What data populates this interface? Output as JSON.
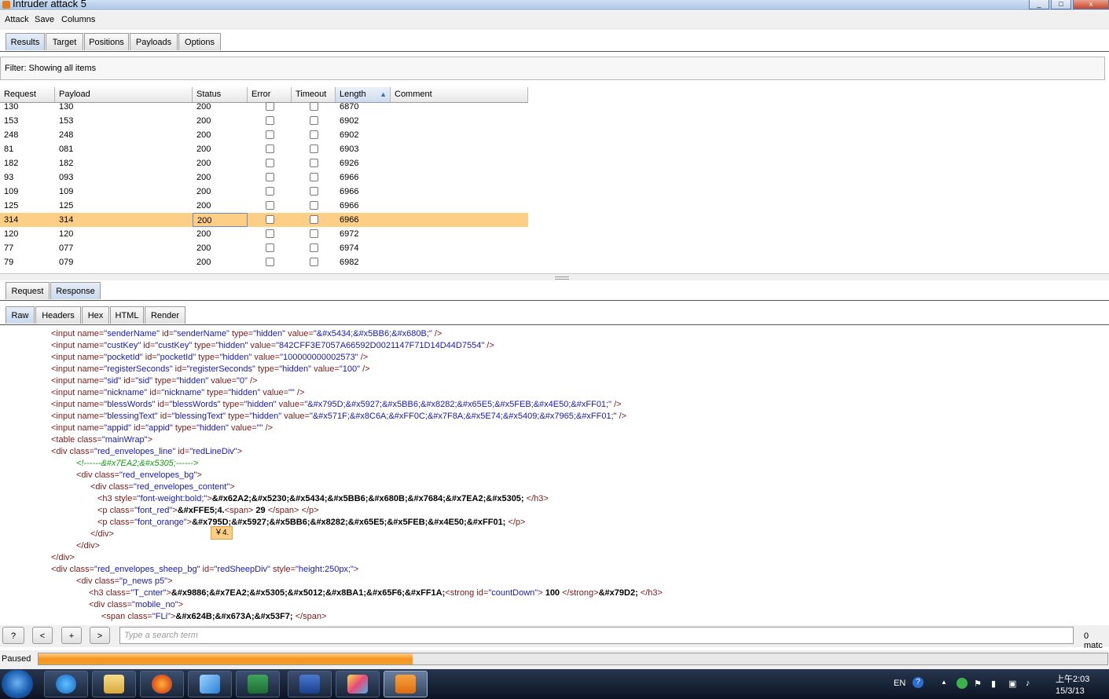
{
  "window": {
    "title": "Intruder attack 5",
    "controls": [
      "_",
      "□",
      "x"
    ]
  },
  "menu": [
    "Attack",
    "Save",
    "Columns"
  ],
  "tabs": [
    "Results",
    "Target",
    "Positions",
    "Payloads",
    "Options"
  ],
  "filter": {
    "text": "Filter:  Showing all items"
  },
  "table": {
    "columns": [
      "Request",
      "Payload",
      "Status",
      "Error",
      "Timeout",
      "Length",
      "Comment"
    ],
    "sorted_column": "Length",
    "rows": [
      {
        "request": "130",
        "payload": "130",
        "status": "200",
        "length": "6870"
      },
      {
        "request": "153",
        "payload": "153",
        "status": "200",
        "length": "6902"
      },
      {
        "request": "248",
        "payload": "248",
        "status": "200",
        "length": "6902"
      },
      {
        "request": "81",
        "payload": "081",
        "status": "200",
        "length": "6903"
      },
      {
        "request": "182",
        "payload": "182",
        "status": "200",
        "length": "6926"
      },
      {
        "request": "93",
        "payload": "093",
        "status": "200",
        "length": "6966"
      },
      {
        "request": "109",
        "payload": "109",
        "status": "200",
        "length": "6966"
      },
      {
        "request": "125",
        "payload": "125",
        "status": "200",
        "length": "6966"
      },
      {
        "request": "314",
        "payload": "314",
        "status": "200",
        "length": "6966",
        "selected": true
      },
      {
        "request": "120",
        "payload": "120",
        "status": "200",
        "length": "6972"
      },
      {
        "request": "77",
        "payload": "077",
        "status": "200",
        "length": "6974"
      },
      {
        "request": "79",
        "payload": "079",
        "status": "200",
        "length": "6982"
      }
    ]
  },
  "detail_tabs": [
    "Request",
    "Response"
  ],
  "view_tabs": [
    "Raw",
    "Headers",
    "Hex",
    "HTML",
    "Render"
  ],
  "code_lines": [
    {
      "indent": 65,
      "parts": [
        [
          "tag",
          "<input "
        ],
        [
          "attr",
          "name="
        ],
        [
          "val",
          "\"senderName\""
        ],
        [
          "attr",
          " id="
        ],
        [
          "val",
          "\"senderName\""
        ],
        [
          "attr",
          " type="
        ],
        [
          "val",
          "\"hidden\""
        ],
        [
          "attr",
          " value="
        ],
        [
          "val",
          "\"&#x5434;&#x5BB6;&#x680B;\""
        ],
        [
          "tag",
          " />"
        ]
      ]
    },
    {
      "indent": 65,
      "parts": [
        [
          "tag",
          "<input "
        ],
        [
          "attr",
          "name="
        ],
        [
          "val",
          "\"custKey\""
        ],
        [
          "attr",
          " id="
        ],
        [
          "val",
          "\"custKey\""
        ],
        [
          "attr",
          " type="
        ],
        [
          "val",
          "\"hidden\""
        ],
        [
          "attr",
          " value="
        ],
        [
          "val",
          "\"842CFF3E7057A66592D0021147F71D14D44D7554\""
        ],
        [
          "tag",
          " />"
        ]
      ]
    },
    {
      "indent": 65,
      "parts": [
        [
          "tag",
          "<input "
        ],
        [
          "attr",
          "name="
        ],
        [
          "val",
          "\"pocketId\""
        ],
        [
          "attr",
          " id="
        ],
        [
          "val",
          "\"pocketId\""
        ],
        [
          "attr",
          " type="
        ],
        [
          "val",
          "\"hidden\""
        ],
        [
          "attr",
          " value="
        ],
        [
          "val",
          "\"100000000002573\""
        ],
        [
          "tag",
          " />"
        ]
      ]
    },
    {
      "indent": 65,
      "parts": [
        [
          "tag",
          "<input "
        ],
        [
          "attr",
          "name="
        ],
        [
          "val",
          "\"registerSeconds\""
        ],
        [
          "attr",
          " id="
        ],
        [
          "val",
          "\"registerSeconds\""
        ],
        [
          "attr",
          " type="
        ],
        [
          "val",
          "\"hidden\""
        ],
        [
          "attr",
          " value="
        ],
        [
          "val",
          "\"100\""
        ],
        [
          "tag",
          " />"
        ]
      ]
    },
    {
      "indent": 65,
      "parts": [
        [
          "tag",
          "<input "
        ],
        [
          "attr",
          "name="
        ],
        [
          "val",
          "\"sid\""
        ],
        [
          "attr",
          " id="
        ],
        [
          "val",
          "\"sid\""
        ],
        [
          "attr",
          " type="
        ],
        [
          "val",
          "\"hidden\""
        ],
        [
          "attr",
          " value="
        ],
        [
          "val",
          "\"0\""
        ],
        [
          "tag",
          " />"
        ]
      ]
    },
    {
      "indent": 65,
      "parts": [
        [
          "tag",
          "<input "
        ],
        [
          "attr",
          "name="
        ],
        [
          "val",
          "\"nickname\""
        ],
        [
          "attr",
          " id="
        ],
        [
          "val",
          "\"nickname\""
        ],
        [
          "attr",
          " type="
        ],
        [
          "val",
          "\"hidden\""
        ],
        [
          "attr",
          " value="
        ],
        [
          "val",
          "\"\""
        ],
        [
          "tag",
          " />"
        ]
      ]
    },
    {
      "indent": 65,
      "parts": [
        [
          "tag",
          "<input "
        ],
        [
          "attr",
          "name="
        ],
        [
          "val",
          "\"blessWords\""
        ],
        [
          "attr",
          " id="
        ],
        [
          "val",
          "\"blessWords\""
        ],
        [
          "attr",
          " type="
        ],
        [
          "val",
          "\"hidden\""
        ],
        [
          "attr",
          " value="
        ],
        [
          "val",
          "\"&#x795D;&#x5927;&#x5BB6;&#x8282;&#x65E5;&#x5FEB;&#x4E50;&#xFF01;\""
        ],
        [
          "tag",
          " />"
        ]
      ]
    },
    {
      "indent": 65,
      "parts": [
        [
          "tag",
          "<input "
        ],
        [
          "attr",
          "name="
        ],
        [
          "val",
          "\"blessingText\""
        ],
        [
          "attr",
          " id="
        ],
        [
          "val",
          "\"blessingText\""
        ],
        [
          "attr",
          " type="
        ],
        [
          "val",
          "\"hidden\""
        ],
        [
          "attr",
          " value="
        ],
        [
          "val",
          "\"&#x571F;&#x8C6A;&#xFF0C;&#x7F8A;&#x5E74;&#x5409;&#x7965;&#xFF01;\""
        ],
        [
          "tag",
          " />"
        ]
      ]
    },
    {
      "indent": 65,
      "parts": [
        [
          "tag",
          "<input "
        ],
        [
          "attr",
          "name="
        ],
        [
          "val",
          "\"appid\""
        ],
        [
          "attr",
          " id="
        ],
        [
          "val",
          "\"appid\""
        ],
        [
          "attr",
          " type="
        ],
        [
          "val",
          "\"hidden\""
        ],
        [
          "attr",
          " value="
        ],
        [
          "val",
          "\"\""
        ],
        [
          "tag",
          " />"
        ]
      ]
    },
    {
      "indent": 65,
      "parts": [
        [
          "tag",
          "<table "
        ],
        [
          "attr",
          "class="
        ],
        [
          "val",
          "\"mainWrap\""
        ],
        [
          "tag",
          ">"
        ]
      ]
    },
    {
      "indent": 65,
      "parts": [
        [
          "tag",
          "<div "
        ],
        [
          "attr",
          "class="
        ],
        [
          "val",
          "\"red_envelopes_line\""
        ],
        [
          "attr",
          " id="
        ],
        [
          "val",
          "\"redLineDiv\""
        ],
        [
          "tag",
          ">"
        ]
      ]
    },
    {
      "indent": 97,
      "parts": [
        [
          "cmt",
          "<!------&#x7EA2;&#x5305;------>"
        ]
      ]
    },
    {
      "indent": 97,
      "parts": [
        [
          "tag",
          "<div "
        ],
        [
          "attr",
          "class="
        ],
        [
          "val",
          "\"red_envelopes_bg\""
        ],
        [
          "tag",
          ">"
        ]
      ]
    },
    {
      "indent": 115,
      "parts": [
        [
          "tag",
          "<div "
        ],
        [
          "attr",
          "class="
        ],
        [
          "val",
          "\"red_envelopes_content\""
        ],
        [
          "tag",
          ">"
        ]
      ]
    },
    {
      "indent": 124,
      "parts": [
        [
          "tag",
          "<h3 "
        ],
        [
          "attr",
          "style="
        ],
        [
          "val",
          "\"font-weight:bold;\""
        ],
        [
          "tag",
          ">"
        ],
        [
          "txt",
          "&#x62A2;&#x5230;&#x5434;&#x5BB6;&#x680B;&#x7684;&#x7EA2;&#x5305;"
        ],
        [
          "tag",
          " </h3>"
        ]
      ]
    },
    {
      "indent": 124,
      "parts": [
        [
          "tag",
          "<p "
        ],
        [
          "attr",
          "class="
        ],
        [
          "val",
          "\"font_red\""
        ],
        [
          "tag",
          ">"
        ],
        [
          "txt",
          "&#xFFE5;4."
        ],
        [
          "tag",
          "<span>"
        ],
        [
          "txt",
          " 29 "
        ],
        [
          "tag",
          "</span> </p>"
        ]
      ]
    },
    {
      "indent": 124,
      "parts": [
        [
          "tag",
          "<p "
        ],
        [
          "attr",
          "class="
        ],
        [
          "val",
          "\"font_orange\""
        ],
        [
          "tag",
          ">"
        ],
        [
          "txt",
          "&#x795D;&#x5927;&#x5BB6;&#x8282;&#x65E5;&#x5FEB;&#x4E50;&#xFF01;"
        ],
        [
          "tag",
          " </p>"
        ]
      ]
    },
    {
      "indent": 115,
      "parts": [
        [
          "tag",
          "</div>"
        ]
      ]
    },
    {
      "indent": 97,
      "parts": [
        [
          "tag",
          "</div>"
        ]
      ]
    },
    {
      "indent": 65,
      "parts": [
        [
          "tag",
          "</div>"
        ]
      ]
    },
    {
      "indent": 65,
      "parts": [
        [
          "tag",
          "<div "
        ],
        [
          "attr",
          "class="
        ],
        [
          "val",
          "\"red_envelopes_sheep_bg\""
        ],
        [
          "attr",
          " id="
        ],
        [
          "val",
          "\"redSheepDiv\""
        ],
        [
          "attr",
          " style="
        ],
        [
          "val",
          "\"height:250px;\""
        ],
        [
          "tag",
          ">"
        ]
      ]
    },
    {
      "indent": 97,
      "parts": [
        [
          "tag",
          "<div "
        ],
        [
          "attr",
          "class="
        ],
        [
          "val",
          "\"p_news p5\""
        ],
        [
          "tag",
          ">"
        ]
      ]
    },
    {
      "indent": 113,
      "parts": [
        [
          "tag",
          "<h3 "
        ],
        [
          "attr",
          "class="
        ],
        [
          "val",
          "\"T_cnter\""
        ],
        [
          "tag",
          ">"
        ],
        [
          "txt",
          "&#x9886;&#x7EA2;&#x5305;&#x5012;&#x8BA1;&#x65F6;&#xFF1A;"
        ],
        [
          "tag",
          "<strong "
        ],
        [
          "attr",
          "id="
        ],
        [
          "val",
          "\"countDown\""
        ],
        [
          "tag",
          ">"
        ],
        [
          "txt",
          " 100 "
        ],
        [
          "tag",
          "</strong>"
        ],
        [
          "txt",
          "&#x79D2;"
        ],
        [
          "tag",
          " </h3>"
        ]
      ]
    },
    {
      "indent": 113,
      "parts": [
        [
          "tag",
          "<div "
        ],
        [
          "attr",
          "class="
        ],
        [
          "val",
          "\"mobile_no\""
        ],
        [
          "tag",
          ">"
        ]
      ]
    },
    {
      "indent": 129,
      "parts": [
        [
          "tag",
          "<span "
        ],
        [
          "attr",
          "class="
        ],
        [
          "val",
          "\"FLi\""
        ],
        [
          "tag",
          ">"
        ],
        [
          "txt",
          "&#x624B;&#x673A;&#x53F7;"
        ],
        [
          "tag",
          " </span>"
        ]
      ]
    }
  ],
  "tooltip": "￥4.",
  "search": {
    "prev": "<",
    "add": "+",
    "next": ">",
    "help": "?",
    "placeholder": "Type a search term",
    "matches": "0 matc"
  },
  "status": {
    "label": "Paused",
    "progress": 0.35
  },
  "taskbar": {
    "apps": [
      "start-orb",
      "internet-explorer",
      "file-explorer",
      "firefox",
      "feiq",
      "excel",
      "visio",
      "paint",
      "burp-suite"
    ],
    "tray": {
      "lang": "EN",
      "time": "上午2:03",
      "date": "15/3/13"
    }
  }
}
